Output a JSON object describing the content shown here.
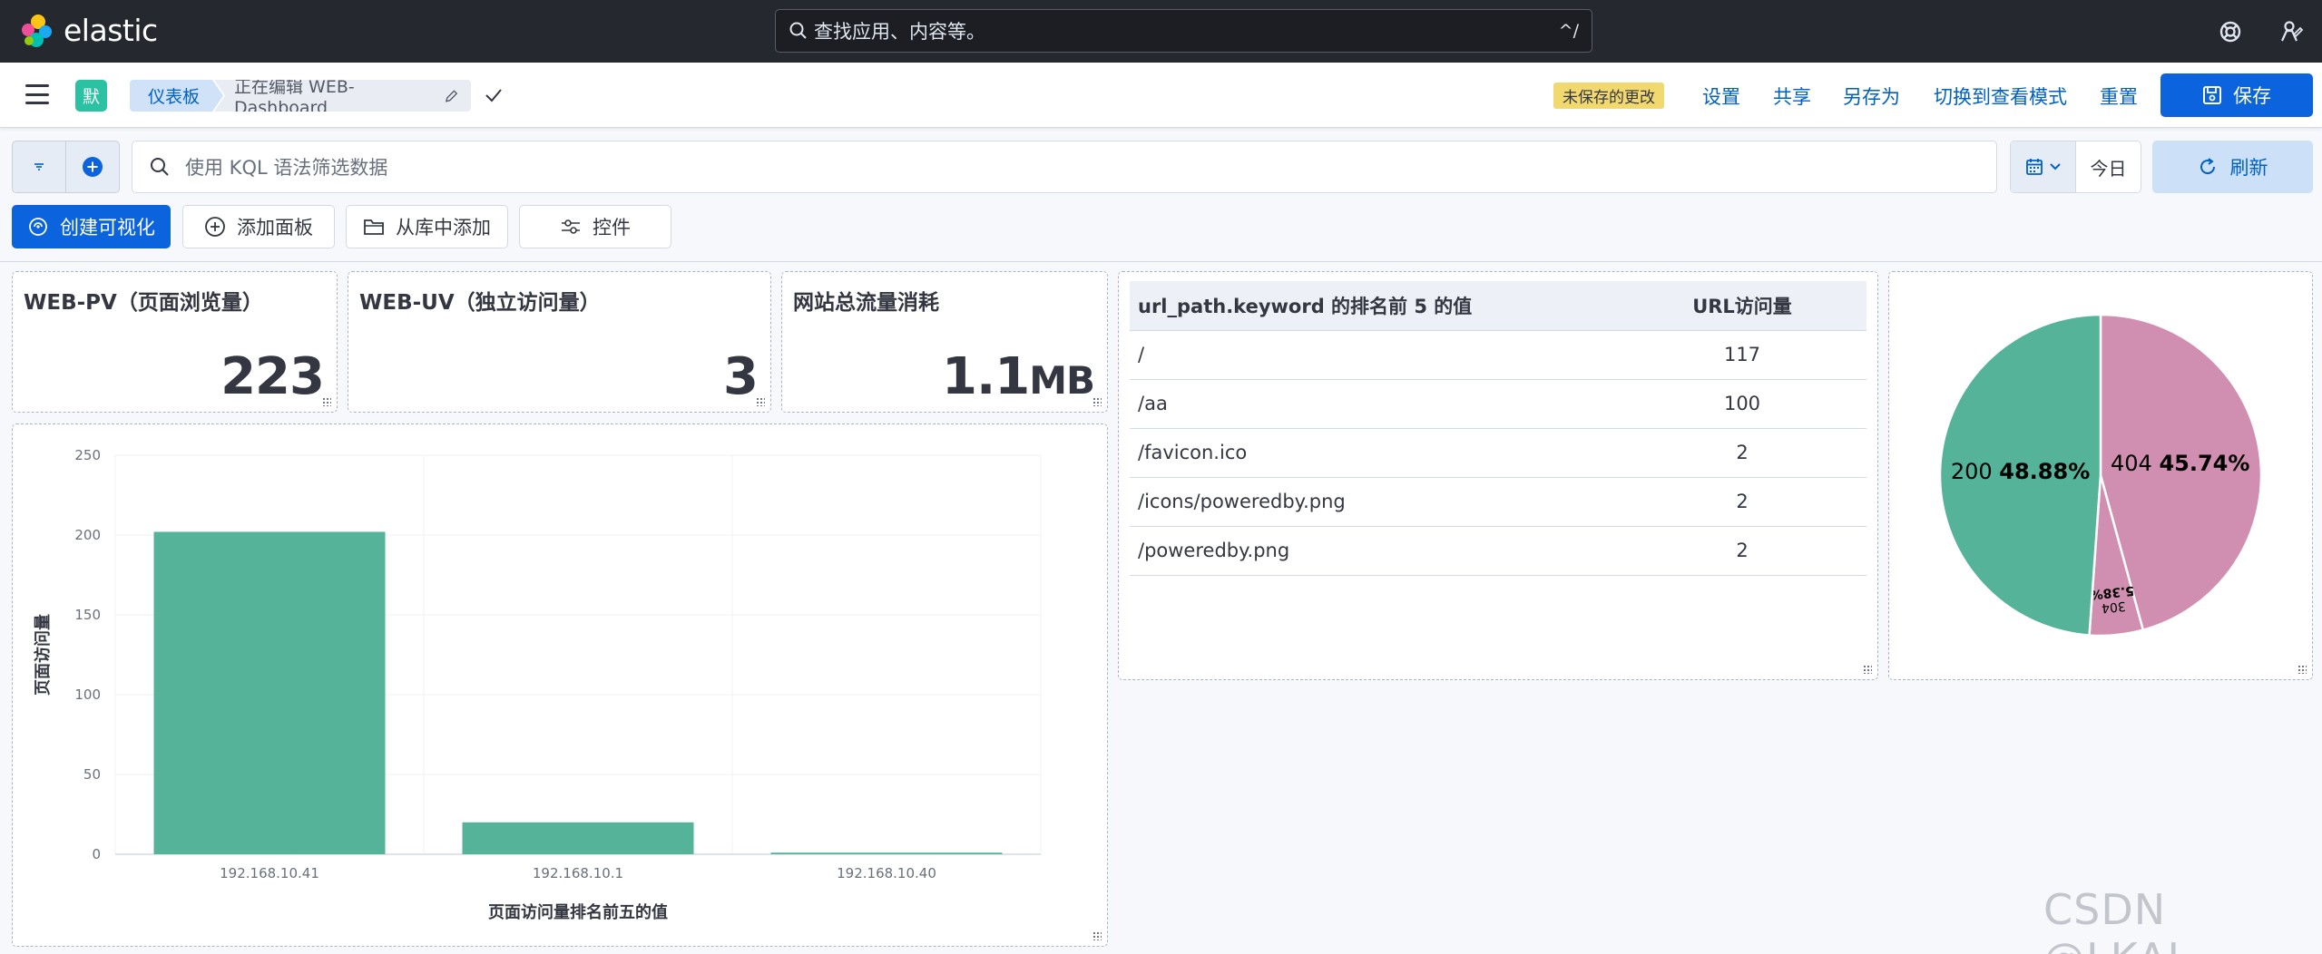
{
  "app": {
    "name": "elastic"
  },
  "search": {
    "placeholder": "查找应用、内容等。",
    "shortcut": "^/"
  },
  "header": {
    "space_initial": "默",
    "breadcrumbs": [
      "仪表板",
      "正在编辑 WEB-Dashboard"
    ],
    "unsaved_badge": "未保存的更改",
    "links": [
      "设置",
      "共享",
      "另存为",
      "切换到查看模式",
      "重置"
    ],
    "save_label": "保存"
  },
  "query": {
    "placeholder": "使用 KQL 语法筛选数据",
    "date_label": "今日",
    "refresh_label": "刷新"
  },
  "toolbar": {
    "create_label": "创建可视化",
    "add_panel_label": "添加面板",
    "add_from_library_label": "从库中添加",
    "controls_label": "控件"
  },
  "metrics": [
    {
      "title": "WEB-PV（页面浏览量）",
      "value": "223",
      "unit": ""
    },
    {
      "title": "WEB-UV（独立访问量）",
      "value": "3",
      "unit": ""
    },
    {
      "title": "网站总流量消耗",
      "value": "1.1",
      "unit": "MB"
    }
  ],
  "table": {
    "headers": [
      "url_path.keyword 的排名前 5 的值",
      "URL访问量"
    ],
    "rows": [
      [
        "/",
        "117"
      ],
      [
        "/aa",
        "100"
      ],
      [
        "/favicon.ico",
        "2"
      ],
      [
        "/icons/poweredby.png",
        "2"
      ],
      [
        "/poweredby.png",
        "2"
      ]
    ]
  },
  "chart_data": [
    {
      "type": "bar",
      "categories": [
        "192.168.10.41",
        "192.168.10.1",
        "192.168.10.40"
      ],
      "values": [
        202,
        20,
        1
      ],
      "xlabel": "页面访问量排名前五的值",
      "ylabel": "页面访问量",
      "yticks": [
        0,
        50,
        100,
        150,
        200,
        250
      ],
      "ylim": [
        0,
        250
      ],
      "grid": true,
      "color": "#54b399"
    },
    {
      "type": "pie",
      "slices": [
        {
          "label": "404",
          "percent": "45.74%",
          "value": 45.74,
          "color": "#d08fb0"
        },
        {
          "label": "304",
          "percent": "5.38%",
          "value": 5.38,
          "color": "#d08fb0"
        },
        {
          "label": "200",
          "percent": "48.88%",
          "value": 48.88,
          "color": "#54b399"
        }
      ]
    }
  ],
  "watermark": "CSDN @LKAI."
}
